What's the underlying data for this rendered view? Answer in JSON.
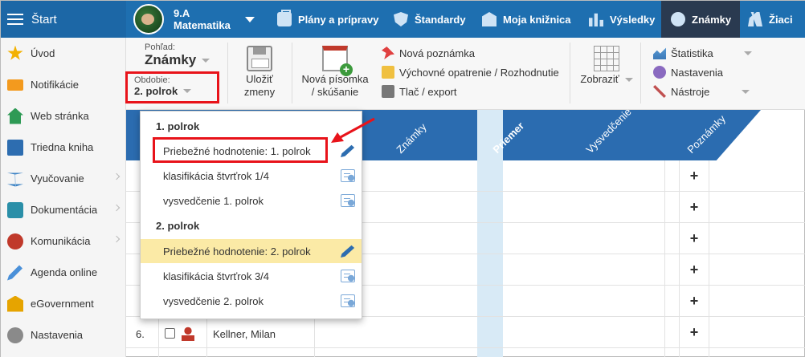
{
  "topbar": {
    "start_label": "Štart",
    "class_name": "9.A",
    "subject": "Matematika",
    "nav": [
      {
        "label": "Plány a prípravy",
        "icon": "briefcase-icon"
      },
      {
        "label": "Štandardy",
        "icon": "shield-icon"
      },
      {
        "label": "Moja knižnica",
        "icon": "library-icon"
      },
      {
        "label": "Výsledky",
        "icon": "bar-chart-icon"
      },
      {
        "label": "Známky",
        "icon": "grade-icon",
        "active": true
      },
      {
        "label": "Žiaci",
        "icon": "students-icon"
      }
    ]
  },
  "sidebar": {
    "items": [
      {
        "label": "Úvod",
        "icon": "star-icon"
      },
      {
        "label": "Notifikácie",
        "icon": "envelope-icon"
      },
      {
        "label": "Web stránka",
        "icon": "house-icon"
      },
      {
        "label": "Triedna kniha",
        "icon": "book-icon"
      },
      {
        "label": "Vyučovanie",
        "icon": "open-book-icon"
      },
      {
        "label": "Dokumentácia",
        "icon": "document-icon"
      },
      {
        "label": "Komunikácia",
        "icon": "chat-icon"
      },
      {
        "label": "Agenda online",
        "icon": "pen-icon"
      },
      {
        "label": "eGovernment",
        "icon": "government-icon"
      },
      {
        "label": "Nastavenia",
        "icon": "gear-icon"
      }
    ]
  },
  "ribbon": {
    "view_label": "Pohľad:",
    "view_value": "Známky",
    "period_label": "Obdobie:",
    "period_value": "2. polrok",
    "save_line1": "Uložiť",
    "save_line2": "zmeny",
    "new_test_line1": "Nová písomka",
    "new_test_line2": "/ skúšanie",
    "new_note": "Nová poznámka",
    "measure": "Výchovné opatrenie / Rozhodnutie",
    "print": "Tlač / export",
    "show": "Zobraziť",
    "stats": "Štatistika",
    "settings": "Nastavenia",
    "tools": "Nástroje"
  },
  "table": {
    "headers": {
      "grades": "Známky",
      "average": "Priemer",
      "certificate": "Vysvedčenie",
      "notes": "Poznámky"
    },
    "visible_row": {
      "number": "6.",
      "name": "Kellner, Milan"
    },
    "add_symbol": "+"
  },
  "dropdown": {
    "group1": "1. polrok",
    "group1_items": [
      {
        "label": "Priebežné hodnotenie: 1. polrok",
        "icon": "pencil-icon"
      },
      {
        "label": "klasifikácia štvrťrok 1/4",
        "icon": "certificate-icon"
      },
      {
        "label": "vysvedčenie 1. polrok",
        "icon": "certificate-icon"
      }
    ],
    "group2": "2. polrok",
    "group2_items": [
      {
        "label": "Priebežné hodnotenie: 2. polrok",
        "icon": "pencil-icon"
      },
      {
        "label": "klasifikácia štvrťrok 3/4",
        "icon": "certificate-icon"
      },
      {
        "label": "vysvedčenie 2. polrok",
        "icon": "certificate-icon"
      }
    ]
  },
  "colors": {
    "topbar": "#1e6fb0",
    "active_nav": "#2a3a50",
    "header": "#2b6cb0",
    "highlight": "#fbeaa6",
    "annotation": "#e8131a"
  }
}
